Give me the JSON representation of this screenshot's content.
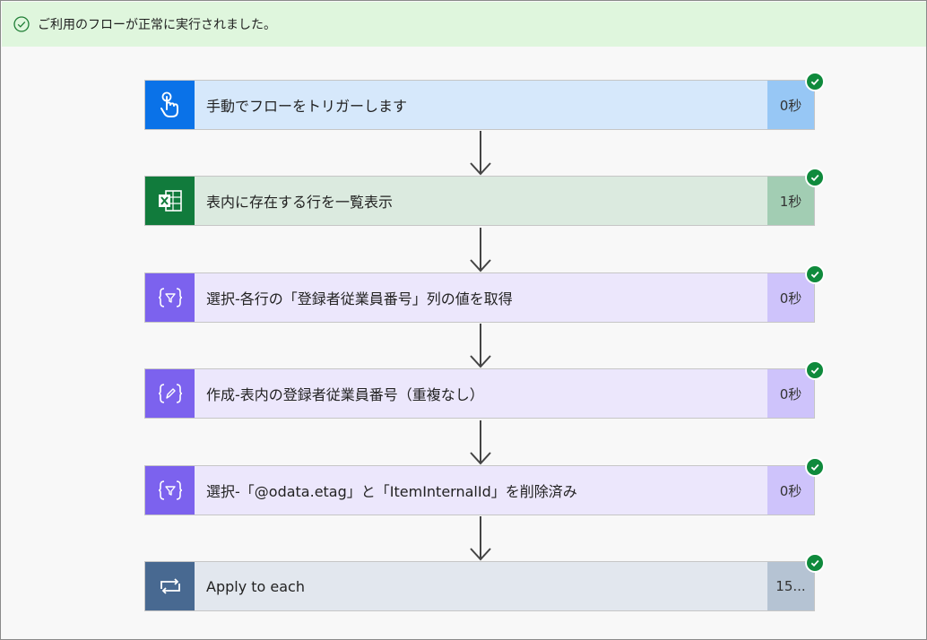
{
  "banner": {
    "message": "ご利用のフローが正常に実行されました。",
    "icon": "circle-check-icon",
    "color": "#dff6dd"
  },
  "steps": [
    {
      "title": "手動でフローをトリガーします",
      "duration": "0秒",
      "icon": "touch-hand-icon",
      "icon_bg": "#0a72e8",
      "body_bg": "#d6e8fb",
      "dur_bg": "#97c7f5"
    },
    {
      "title": "表内に存在する行を一覧表示",
      "duration": "1秒",
      "icon": "excel-icon",
      "icon_bg": "#117b3c",
      "body_bg": "#dbeadf",
      "dur_bg": "#a2cdb3"
    },
    {
      "title": "選択-各行の「登録者従業員番号」列の値を取得",
      "duration": "0秒",
      "icon": "data-select-icon",
      "icon_bg": "#7c62ee",
      "body_bg": "#ece7fc",
      "dur_bg": "#cec3fb"
    },
    {
      "title": "作成-表内の登録者従業員番号（重複なし）",
      "duration": "0秒",
      "icon": "data-compose-icon",
      "icon_bg": "#7c62ee",
      "body_bg": "#ece7fc",
      "dur_bg": "#cec3fb"
    },
    {
      "title": "選択-「@odata.etag」と「ItemInternalId」を削除済み",
      "duration": "0秒",
      "icon": "data-select-icon",
      "icon_bg": "#7c62ee",
      "body_bg": "#ece7fc",
      "dur_bg": "#cec3fb"
    },
    {
      "title": "Apply to each",
      "duration": "15...",
      "icon": "loop-icon",
      "icon_bg": "#486991",
      "body_bg": "#e2e7ee",
      "dur_bg": "#b5c3d3"
    }
  ],
  "status_check_color": "#0f8a3c"
}
